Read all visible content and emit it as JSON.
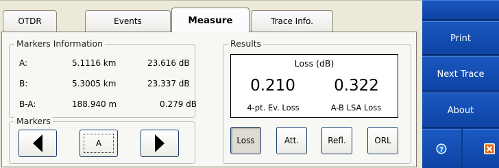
{
  "tabs": [
    {
      "label": "OTDR"
    },
    {
      "label": "Events"
    },
    {
      "label": "Measure"
    },
    {
      "label": "Trace Info."
    }
  ],
  "active_tab": "Measure",
  "markers_info": {
    "legend": "Markers Information",
    "rows": [
      {
        "label": "A:",
        "distance": "5.1116 km",
        "level": "23.616 dB"
      },
      {
        "label": "B:",
        "distance": "5.3005 km",
        "level": "23.337 dB"
      },
      {
        "label": "B-A:",
        "distance": "188.940 m",
        "level": "0.279 dB"
      }
    ]
  },
  "markers": {
    "legend": "Markers",
    "selected": "A"
  },
  "results": {
    "legend": "Results",
    "header": "Loss (dB)",
    "value_left": "0.210",
    "value_right": "0.322",
    "label_left": "4-pt. Ev. Loss",
    "label_right": "A-B LSA Loss",
    "buttons": [
      "Loss",
      "Att.",
      "Refl.",
      "ORL"
    ],
    "pressed": "Loss"
  },
  "sidebar": {
    "print_label": "Print",
    "next_trace_label": "Next Trace",
    "about_label": "About"
  },
  "colors": {
    "sidebar": "#0e43a3",
    "help_icon": "#1c6fd6",
    "close_icon": "#e86a10"
  }
}
